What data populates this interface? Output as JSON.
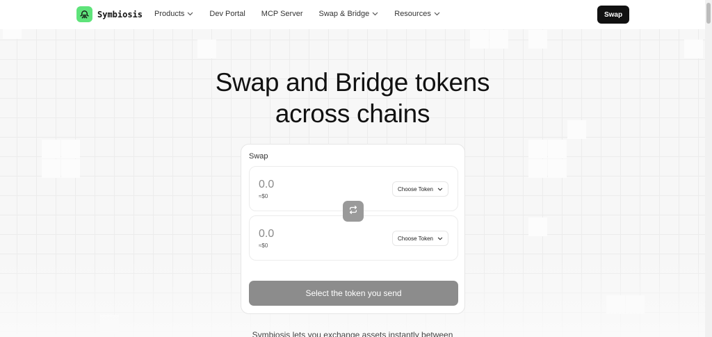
{
  "header": {
    "logo_text": "Symbiosis",
    "nav": [
      {
        "label": "Products",
        "dropdown": true
      },
      {
        "label": "Dev Portal",
        "dropdown": false
      },
      {
        "label": "MCP Server",
        "dropdown": false
      },
      {
        "label": "Swap & Bridge",
        "dropdown": true
      },
      {
        "label": "Resources",
        "dropdown": true
      }
    ],
    "swap_button": "Swap"
  },
  "hero": {
    "title_line1": "Swap and Bridge tokens",
    "title_line2": "across chains"
  },
  "swap_card": {
    "title": "Swap",
    "from": {
      "amount_placeholder": "0.0",
      "usd_value": "≈$0",
      "token_button": "Choose Token"
    },
    "to": {
      "amount_placeholder": "0.0",
      "usd_value": "≈$0",
      "token_button": "Choose Token"
    },
    "submit_label": "Select the token you send"
  },
  "tagline": "Symbiosis lets you exchange assets instantly between",
  "icons": {
    "logo": "octopus-icon",
    "flip": "swap-arrows-icon",
    "dropdown": "chevron-down-icon"
  },
  "colors": {
    "brand_green": "#5ee37a",
    "header_button": "#111111",
    "submit_disabled": "#8c8c8c",
    "flip_button": "#9a9a9a"
  }
}
